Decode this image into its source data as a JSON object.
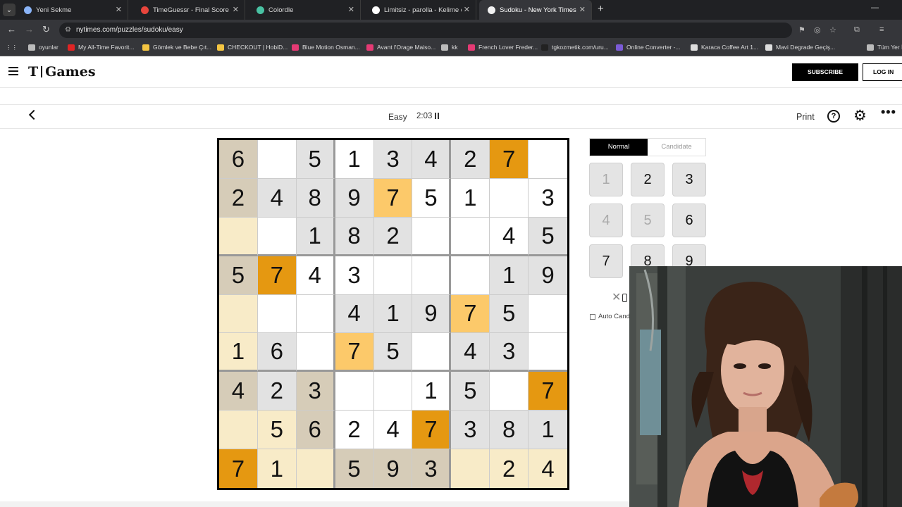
{
  "browser": {
    "tabs": [
      {
        "title": "Yeni Sekme",
        "color": "#8ab4f8",
        "active": false
      },
      {
        "title": "TimeGuessr - Final Score",
        "color": "#e8453c",
        "active": false
      },
      {
        "title": "Colordle",
        "color": "#49c2a3",
        "active": false
      },
      {
        "title": "Limitsiz - parolla - Kelime oyun",
        "color": "#ffffff",
        "active": false
      },
      {
        "title": "Sudoku - New York Times Num",
        "color": "#f2f2f2",
        "active": true
      }
    ],
    "url": "nytimes.com/puzzles/sudoku/easy",
    "bookmarks": [
      {
        "label": "oyunlar",
        "color": "#bbbbbb"
      },
      {
        "label": "My All-Time Favorit...",
        "color": "#e02424"
      },
      {
        "label": "Gömlek ve Bebe Çıt...",
        "color": "#f4c542"
      },
      {
        "label": "CHECKOUT | HobiD...",
        "color": "#f4c542"
      },
      {
        "label": "Blue Motion Osman...",
        "color": "#e53a74"
      },
      {
        "label": "Avant l'Orage Maiso...",
        "color": "#e53a74"
      },
      {
        "label": "kk",
        "color": "#bbbbbb"
      },
      {
        "label": "French Lover Freder...",
        "color": "#e53a74"
      },
      {
        "label": "tgkozmetik.com/uru...",
        "color": "#222222"
      },
      {
        "label": "Online Converter -...",
        "color": "#7b5bd6"
      },
      {
        "label": "Karaca Coffee Art 1...",
        "color": "#dddddd"
      },
      {
        "label": "Mavi Degrade Geçiş...",
        "color": "#dddddd"
      },
      {
        "label": "Tüm Yer İşaretleri",
        "color": "#bbbbbb"
      }
    ]
  },
  "header": {
    "logo_t": "T",
    "logo_text": "Games",
    "subscribe": "SUBSCRIBE",
    "login": "LOG IN"
  },
  "status": {
    "difficulty": "Easy",
    "timer": "2:03",
    "print": "Print",
    "help": "?",
    "more": "•••"
  },
  "board": {
    "cells": [
      [
        "6",
        "",
        "5",
        "1",
        "3",
        "4",
        "2",
        "7",
        ""
      ],
      [
        "2",
        "4",
        "8",
        "9",
        "7",
        "5",
        "1",
        "",
        "3"
      ],
      [
        "",
        "",
        "1",
        "8",
        "2",
        "",
        "",
        "4",
        "5"
      ],
      [
        "5",
        "7",
        "4",
        "3",
        "",
        "",
        "",
        "1",
        "9"
      ],
      [
        "",
        "",
        "",
        "4",
        "1",
        "9",
        "7",
        "5",
        ""
      ],
      [
        "1",
        "6",
        "",
        "7",
        "5",
        "",
        "4",
        "3",
        ""
      ],
      [
        "4",
        "2",
        "3",
        "",
        "",
        "1",
        "5",
        "",
        "7"
      ],
      [
        "",
        "5",
        "6",
        "2",
        "4",
        "7",
        "3",
        "8",
        "1"
      ],
      [
        "7",
        "1",
        "",
        "5",
        "9",
        "3",
        "",
        "2",
        "4"
      ]
    ],
    "shades": [
      [
        "T",
        "W",
        "G",
        "W",
        "G",
        "G",
        "G",
        "O",
        "W"
      ],
      [
        "T",
        "G",
        "G",
        "G",
        "P",
        "W",
        "W",
        "W",
        "W"
      ],
      [
        "C",
        "W",
        "G",
        "G",
        "G",
        "W",
        "W",
        "W",
        "G"
      ],
      [
        "T",
        "O",
        "W",
        "W",
        "W",
        "W",
        "W",
        "G",
        "G"
      ],
      [
        "C",
        "W",
        "W",
        "G",
        "G",
        "G",
        "P",
        "G",
        "W"
      ],
      [
        "C",
        "G",
        "W",
        "P",
        "G",
        "W",
        "G",
        "G",
        "W"
      ],
      [
        "T",
        "G",
        "T",
        "W",
        "W",
        "W",
        "G",
        "W",
        "O"
      ],
      [
        "C",
        "C",
        "T",
        "W",
        "W",
        "O",
        "G",
        "G",
        "G"
      ],
      [
        "O",
        "C",
        "C",
        "T",
        "T",
        "T",
        "C",
        "C",
        "C"
      ]
    ],
    "palette": {
      "W": "#ffffff",
      "G": "#e2e2e2",
      "T": "#d6ccb8",
      "C": "#f8ebc8",
      "P": "#fcc96a",
      "O": "#e59811"
    }
  },
  "controls": {
    "mode_normal": "Normal",
    "mode_candidate": "Candidate",
    "numbers": [
      {
        "n": "1",
        "used": true
      },
      {
        "n": "2",
        "used": false
      },
      {
        "n": "3",
        "used": false
      },
      {
        "n": "4",
        "used": true
      },
      {
        "n": "5",
        "used": true
      },
      {
        "n": "6",
        "used": false
      },
      {
        "n": "7",
        "used": false
      },
      {
        "n": "8",
        "used": false
      },
      {
        "n": "9",
        "used": false
      }
    ],
    "erase": "✕",
    "auto_candidate": "Auto Candidate"
  }
}
